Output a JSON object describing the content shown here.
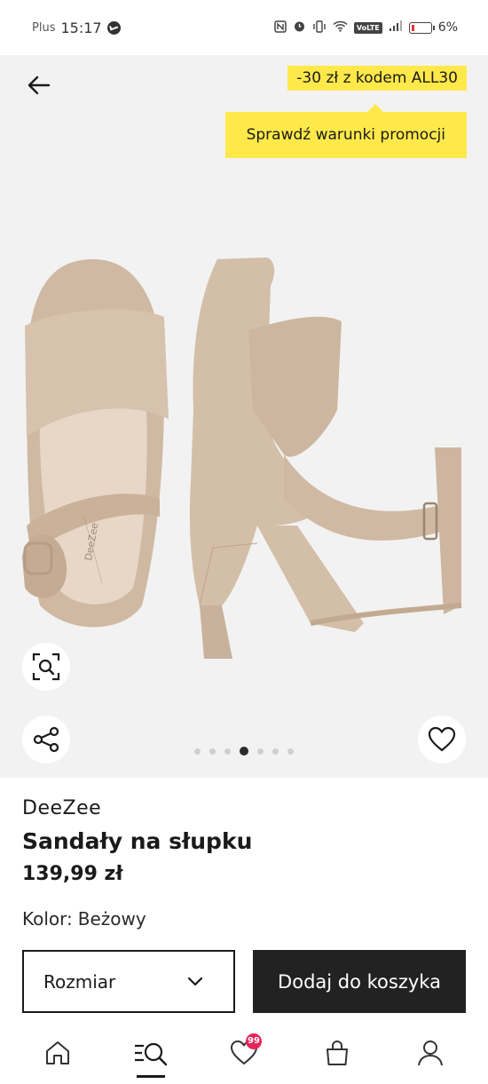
{
  "status_bar": {
    "carrier": "Plus",
    "time": "15:17",
    "battery": "6%"
  },
  "promo": {
    "code_text": "-30 zł z kodem ALL30",
    "link_text": "Sprawdź warunki promocji"
  },
  "gallery": {
    "dots_total": 7,
    "active_dot": 4,
    "shoe_brand_print": "DeeZee"
  },
  "product": {
    "brand": "DeeZee",
    "name": "Sandały na słupku",
    "price": "139,99 zł",
    "color_label": "Kolor:",
    "color_value": "Beżowy"
  },
  "actions": {
    "size_label": "Rozmiar",
    "add_to_cart": "Dodaj do koszyka"
  },
  "bottom_nav": {
    "wishlist_badge": "99"
  },
  "colors": {
    "promo_yellow": "#ffe94a",
    "primary_dark": "#222222",
    "badge_pink": "#e8245a",
    "hero_bg": "#f2f2f2"
  }
}
